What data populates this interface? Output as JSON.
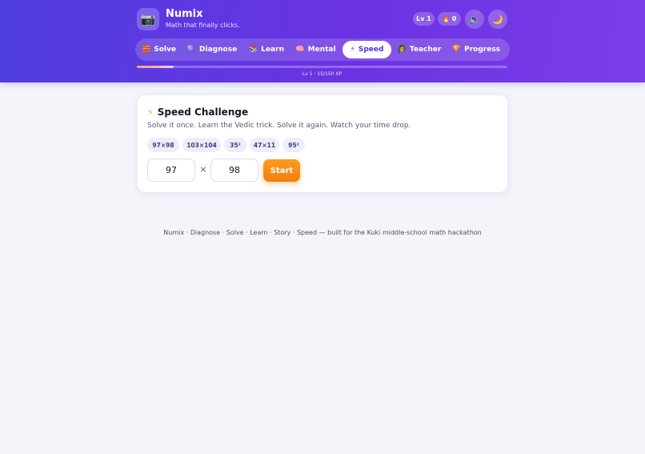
{
  "app": {
    "logo_glyph": "📷",
    "title": "Numix",
    "subtitle": "Math that finally clicks."
  },
  "header_stats": {
    "level": "Lv 1",
    "streak_icon": "🔥",
    "streak": "0",
    "sound_icon": "🔈",
    "theme_icon": "🌙"
  },
  "nav": {
    "tabs": [
      {
        "icon": "🧱",
        "label": "Solve",
        "active": false
      },
      {
        "icon": "🔍",
        "label": "Diagnose",
        "active": false
      },
      {
        "icon": "📚",
        "label": "Learn",
        "active": false
      },
      {
        "icon": "🧠",
        "label": "Mental",
        "active": false
      },
      {
        "icon": "⚡",
        "label": "Speed",
        "active": true
      },
      {
        "icon": "👩‍🏫",
        "label": "Teacher",
        "active": false
      },
      {
        "icon": "🏆",
        "label": "Progress",
        "active": false
      }
    ]
  },
  "xp": {
    "label": "Lv 1 · 15/150 XP",
    "current": 15,
    "max": 150
  },
  "speed_challenge": {
    "icon": "⚡",
    "title": "Speed Challenge",
    "description": "Solve it once. Learn the Vedic trick. Solve it again. Watch your time drop.",
    "presets": [
      "97×98",
      "103×104",
      "35²",
      "47×11",
      "95²"
    ],
    "operand_a": "97",
    "operator": "×",
    "operand_b": "98",
    "start_label": "Start"
  },
  "footer": {
    "text": "Numix · Diagnose · Solve · Learn · Story · Speed — built for the Kuki middle-school math hackathon"
  },
  "colors": {
    "header_start": "#4f3ee0",
    "header_end": "#7b3de8",
    "accent_orange": "#f57d0c",
    "chip_bg": "#eeedfb",
    "page_bg": "#f4f5fb"
  }
}
